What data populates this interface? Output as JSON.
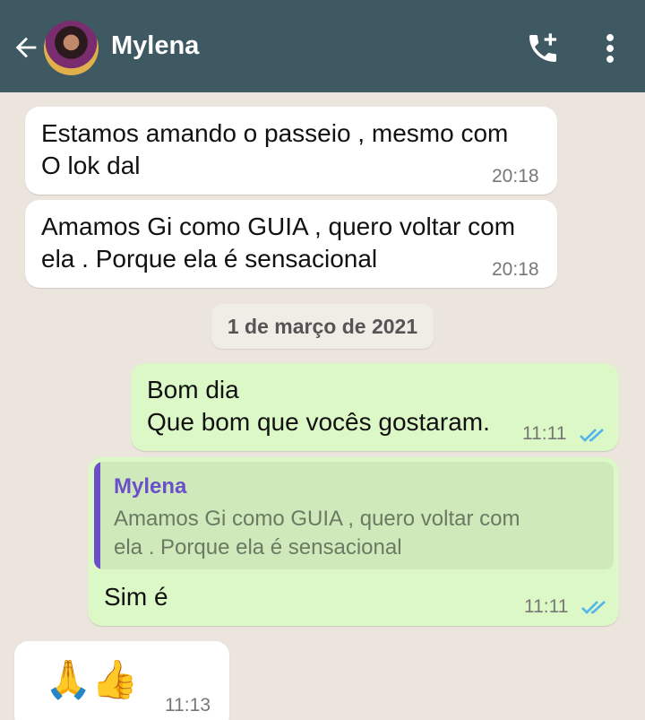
{
  "header": {
    "contact_name": "Mylena",
    "back_icon": "arrow-left-icon",
    "call_icon": "add-call-icon",
    "menu_icon": "more-vert-icon"
  },
  "colors": {
    "header_bg": "#3f5963",
    "chat_bg": "#ece5dd",
    "incoming_bubble": "#ffffff",
    "outgoing_bubble": "#dcf8c6",
    "read_ticks": "#4fb6ec",
    "quote_accent": "#6a4fc9"
  },
  "messages": [
    {
      "direction": "in",
      "text": "Estamos amando o passeio , mesmo com\nO lok dal",
      "time": "20:18"
    },
    {
      "direction": "in",
      "text": "Amamos Gi como GUIA , quero voltar com\nela . Porque ela é sensacional",
      "time": "20:18"
    },
    {
      "type": "date",
      "text": "1 de março de 2021"
    },
    {
      "direction": "out",
      "text": "Bom dia\nQue bom que vocês gostaram.",
      "time": "11:11",
      "status": "read"
    },
    {
      "direction": "out",
      "quote": {
        "author": "Mylena",
        "text": "Amamos Gi como GUIA , quero voltar com\nela . Porque ela é sensacional"
      },
      "text": "Sim é",
      "time": "11:11",
      "status": "read"
    },
    {
      "direction": "in",
      "text": "🙏👍",
      "time": "11:13"
    }
  ]
}
